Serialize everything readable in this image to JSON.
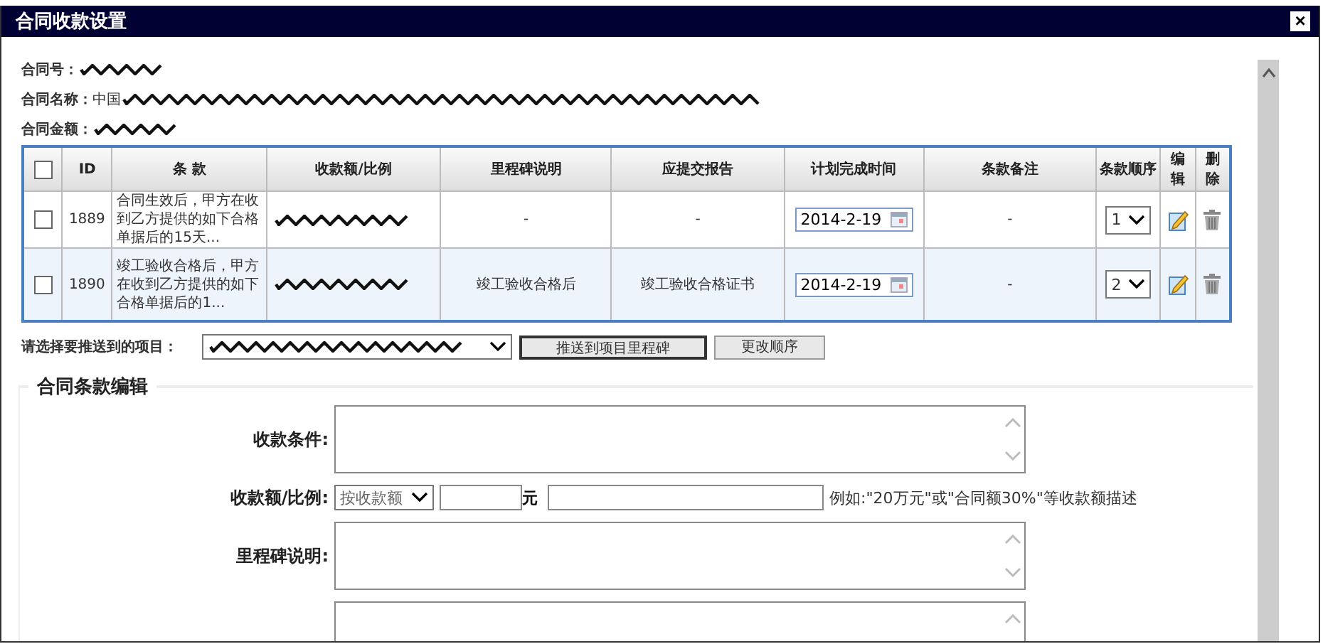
{
  "window": {
    "title": "合同收款设置",
    "close": "×"
  },
  "contract": [
    {
      "label": "合同号：",
      "redacted": true
    },
    {
      "label": "合同名称：",
      "value": "中国",
      "redacted": true
    },
    {
      "label": "合同金额：",
      "redacted": true
    }
  ],
  "table": {
    "columns": [
      "ID",
      "条 款",
      "收款额/比例",
      "里程碑说明",
      "应提交报告",
      "计划完成时间",
      "条款备注",
      "条款顺序",
      "编辑",
      "删除"
    ],
    "header_checked": false,
    "rows": [
      {
        "checked": false,
        "id": "1889",
        "clause": "合同生效后，甲方在收到乙方提供的如下合格单据后的15天...",
        "amount_redacted": true,
        "milestone": "-",
        "report": "-",
        "date": "2014-2-19",
        "note": "-",
        "order": "1"
      },
      {
        "checked": false,
        "id": "1890",
        "clause": "竣工验收合格后，甲方在收到乙方提供的如下合格单据后的1...",
        "amount_redacted": true,
        "milestone": "竣工验收合格后",
        "report": "竣工验收合格证书",
        "date": "2014-2-19",
        "note": "-",
        "order": "2"
      }
    ]
  },
  "push": {
    "label": "请选择要推送到的项目：",
    "project_redacted": true,
    "buttons": [
      {
        "label": "推送到项目里程碑",
        "focused": true
      },
      {
        "label": "更改顺序",
        "focused": false
      }
    ]
  },
  "form": {
    "legend": "合同条款编辑",
    "rows": [
      {
        "kind": "textarea",
        "label": "收款条件:"
      },
      {
        "kind": "amount",
        "label": "收款额/比例:",
        "select": "按收款额",
        "unit": "元",
        "hint": "例如:\"20万元\"或\"合同额30%\"等收款额描述"
      },
      {
        "kind": "textarea",
        "label": "里程碑说明:"
      },
      {
        "kind": "textarea_cut",
        "label": ""
      }
    ]
  }
}
